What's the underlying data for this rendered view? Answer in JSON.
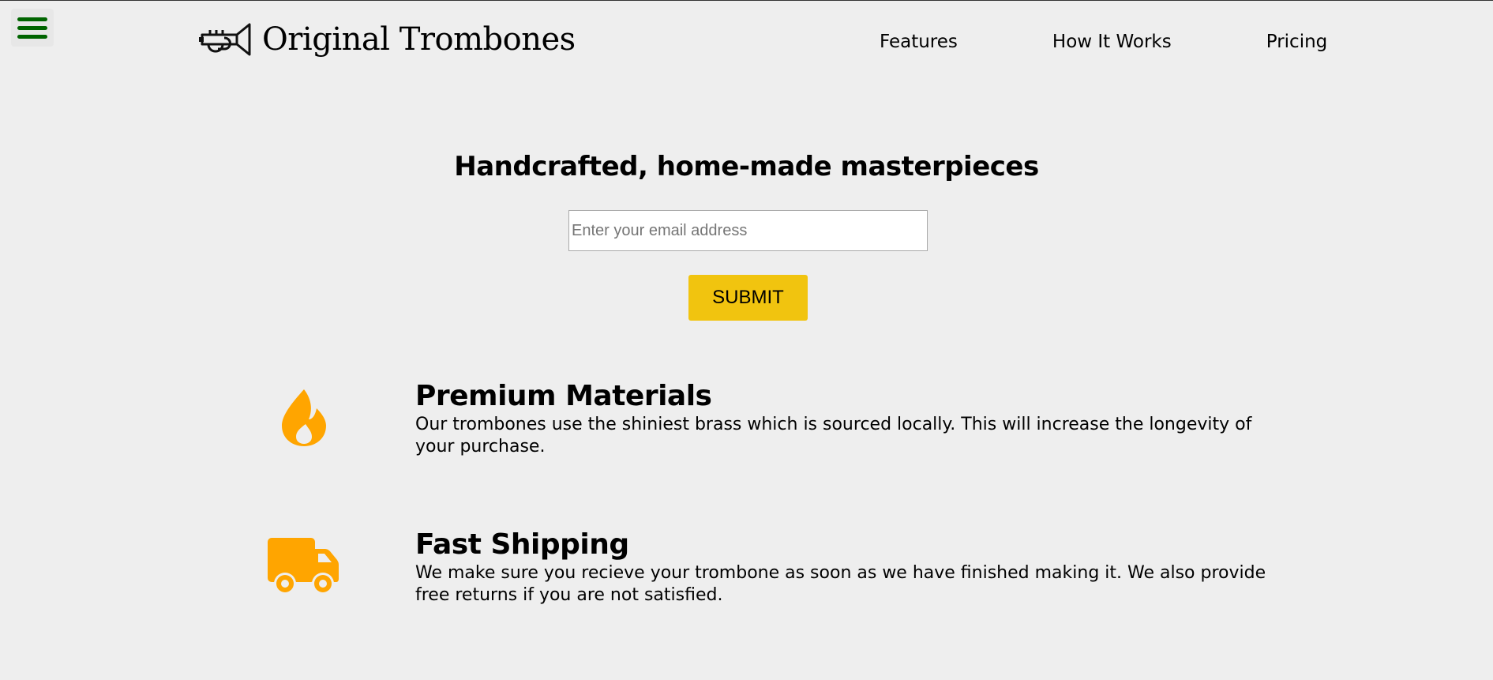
{
  "header": {
    "menu_icon": "hamburger-menu-icon",
    "menu_color": "#006400",
    "logo_icon": "trumpet-icon",
    "logo_text": "Original Trombones",
    "nav": [
      {
        "label": "Features"
      },
      {
        "label": "How It Works"
      },
      {
        "label": "Pricing"
      }
    ]
  },
  "hero": {
    "title": "Handcrafted, home-made masterpieces",
    "email_placeholder": "Enter your email address",
    "submit_label": "SUBMIT",
    "submit_color": "#f1c40f"
  },
  "features": [
    {
      "icon": "fire-icon",
      "title": "Premium Materials",
      "description": "Our trombones use the shiniest brass which is sourced locally. This will increase the longevity of your purchase."
    },
    {
      "icon": "truck-icon",
      "title": "Fast Shipping",
      "description": "We make sure you recieve your trombone as soon as we have finished making it. We also provide free returns if you are not satisfied."
    }
  ],
  "colors": {
    "background": "#eeeeee",
    "accent_icon": "#ffa500"
  }
}
